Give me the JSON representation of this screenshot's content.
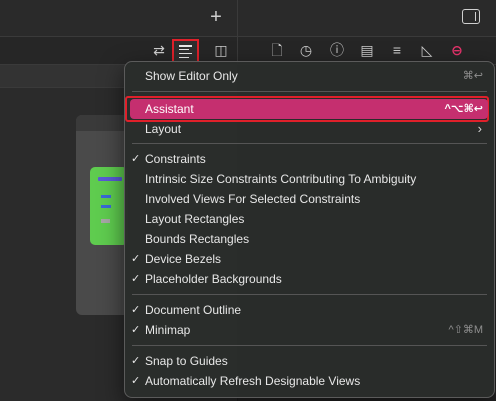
{
  "toolbar": {
    "plus_icon": "plus-icon",
    "inspector_icon": "sidebar-right-icon",
    "editor_icons": [
      "arrows-swap-icon",
      "editor-options-icon",
      "add-editor-right-icon"
    ],
    "inspector_icons": [
      "file-icon",
      "history-icon",
      "help-icon",
      "identity-icon",
      "attributes-icon",
      "size-icon",
      "connections-icon"
    ],
    "accent_color": "#e8336c"
  },
  "menu": {
    "items": [
      {
        "label": "Show Editor Only",
        "shortcut": "⌘↩",
        "checked": false
      },
      {
        "label": "Assistant",
        "shortcut": "^⌥⌘↩",
        "checked": false,
        "selected": true
      },
      {
        "label": "Layout",
        "submenu": true,
        "checked": false
      },
      {
        "label": "Constraints",
        "checked": true
      },
      {
        "label": "Intrinsic Size Constraints Contributing To Ambiguity",
        "checked": false
      },
      {
        "label": "Involved Views For Selected Constraints",
        "checked": false
      },
      {
        "label": "Layout Rectangles",
        "checked": false
      },
      {
        "label": "Bounds Rectangles",
        "checked": false
      },
      {
        "label": "Device Bezels",
        "checked": true
      },
      {
        "label": "Placeholder Backgrounds",
        "checked": true
      },
      {
        "label": "Document Outline",
        "checked": true
      },
      {
        "label": "Minimap",
        "shortcut": "^⇧⌘M",
        "checked": true
      },
      {
        "label": "Snap to Guides",
        "checked": true
      },
      {
        "label": "Automatically Refresh Designable Views",
        "checked": true
      }
    ],
    "check_glyph": "✓",
    "submenu_glyph": "›",
    "selected_color": "#c52f6f"
  }
}
